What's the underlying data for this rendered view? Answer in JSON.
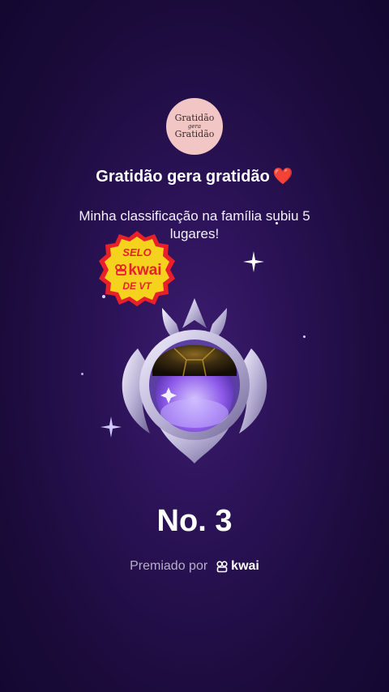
{
  "avatar": {
    "line1": "Gratidão",
    "line2": "gera",
    "line3": "Gratidão"
  },
  "header": {
    "title": "Gratidão gera gratidão",
    "emoji": "❤️"
  },
  "message": "Minha classificação na família subiu 5 lugares!",
  "seal": {
    "top": "SELO",
    "brand": "kwai",
    "bottom": "DE VT"
  },
  "rank": "No. 3",
  "footer": {
    "label": "Premiado por",
    "brand": "kwai"
  },
  "colors": {
    "seal_fill": "#f5d21e",
    "seal_ring": "#e8202a",
    "heart": "#e3212d",
    "background": "#2a1255"
  }
}
